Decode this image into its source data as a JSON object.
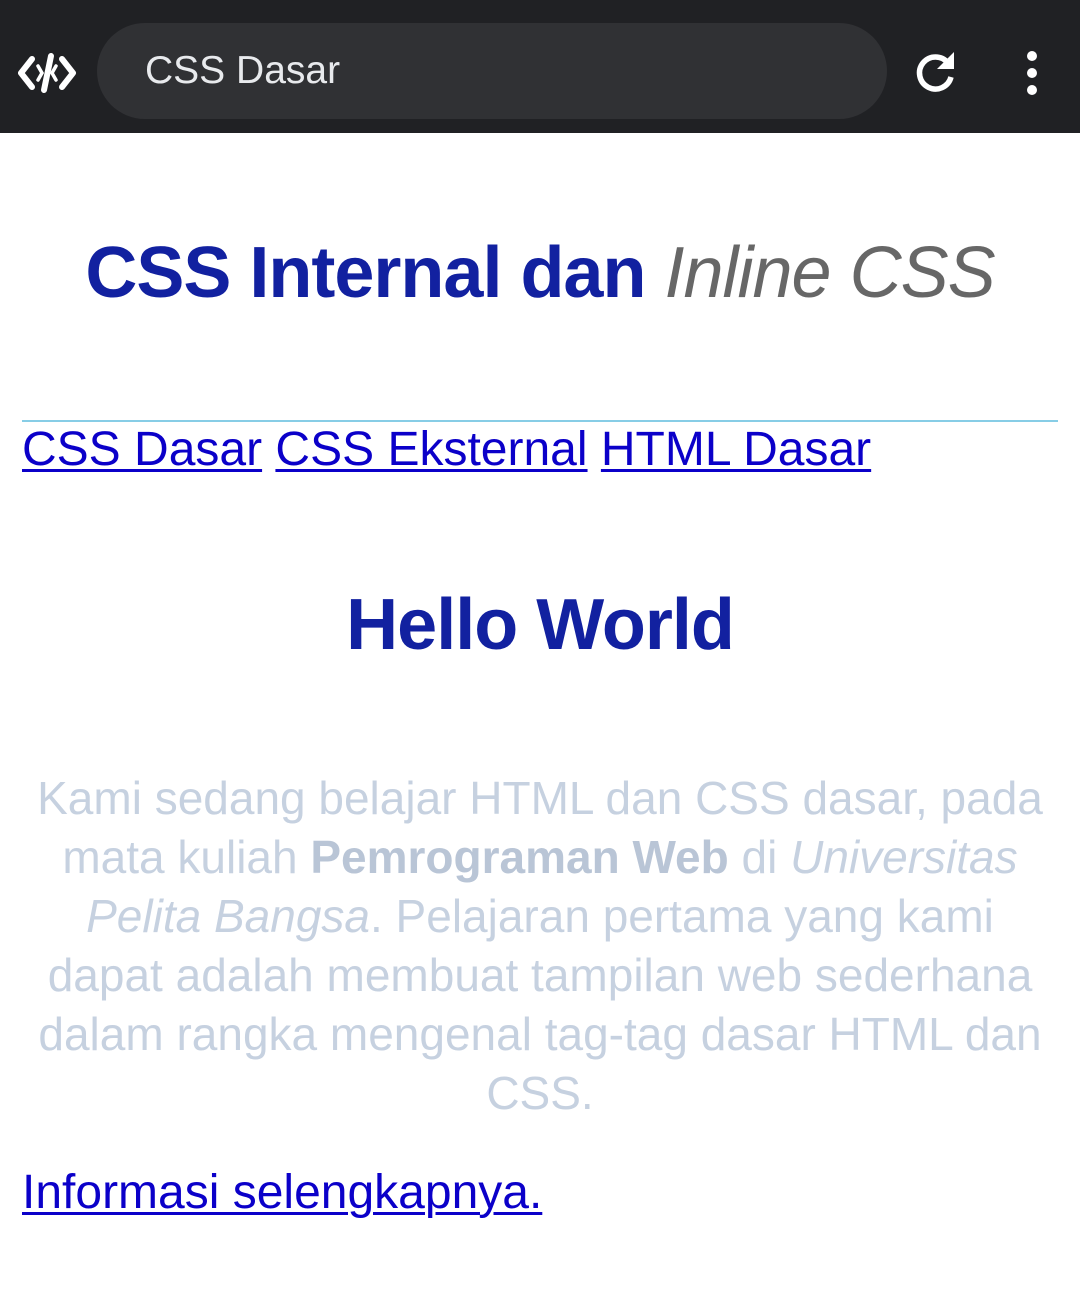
{
  "browser": {
    "tab_title": "CSS Dasar",
    "app_icon": "code-editor-icon",
    "reload_icon": "reload-icon",
    "menu_icon": "more-vert-icon"
  },
  "page": {
    "title_main": "CSS Internal dan",
    "title_italic": "Inline CSS",
    "nav_links": [
      "CSS Dasar",
      "CSS Eksternal",
      "HTML Dasar"
    ],
    "heading": "Hello World",
    "paragraph": {
      "part1": "Kami sedang belajar HTML dan CSS dasar, pada mata kuliah ",
      "bold": "Pemrograman Web",
      "part2": " di ",
      "italic": "Universitas Pelita Bangsa",
      "part3": ". Pelajaran pertama yang kami dapat adalah membuat tampilan web sederhana dalam rangka mengenal tag-tag dasar HTML dan CSS."
    },
    "more_link": "Informasi selengkapnya."
  },
  "colors": {
    "toolbar_bg": "#202124",
    "urlbar_bg": "#303134",
    "heading": "#1221a0",
    "link": "#0b00c9",
    "paragraph": "#c6d1e0",
    "divider": "#87cde6"
  }
}
